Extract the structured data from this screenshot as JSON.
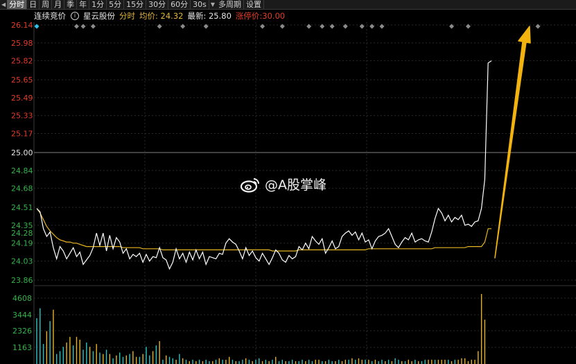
{
  "toolbar": {
    "items": [
      "分时",
      "日",
      "周",
      "月",
      "季",
      "年",
      "1分",
      "5分",
      "15分",
      "30分",
      "60分",
      "30s",
      "多周期",
      "设置"
    ],
    "active_index": 0
  },
  "info": {
    "auction_label": "连续竞价",
    "stock_name": "星云股份",
    "mode": "分时",
    "avg_text": "均价: 24.32",
    "latest_text": "最新: 25.80",
    "limit_text": "涨停价:30.00"
  },
  "colors": {
    "price_line": "#ffffff",
    "avg_line": "#e6b422",
    "up": "#e23c2c",
    "down": "#35b34a",
    "volume_cyan": "#2ec4c4",
    "arrow": "#f2b30f",
    "grid": "#2a2a2a"
  },
  "chart_data": {
    "type": "line",
    "price_ticks": [
      "26.14",
      "25.98",
      "25.82",
      "25.65",
      "25.49",
      "25.33",
      "25.17",
      "25.00",
      "24.84",
      "24.68",
      "24.51",
      "24.35",
      "24.19",
      "24.03",
      "23.86"
    ],
    "price_markers": [
      "24.28"
    ],
    "ref_price": "25.00",
    "ylim": [
      23.86,
      26.14
    ],
    "volume_ticks": [
      "4608",
      "3444",
      "2326",
      "1163"
    ],
    "volume_max": 4608,
    "series": [
      {
        "values": [
          24.5,
          24.47,
          24.32,
          24.25,
          24.29,
          24.15,
          24.05,
          24.16,
          24.12,
          24.05,
          24.1,
          24.15,
          24.07,
          24.11,
          24.0,
          24.04,
          24.08,
          24.15,
          24.28,
          24.17,
          24.28,
          24.12,
          24.26,
          24.14,
          24.24,
          24.2,
          24.1,
          24.14,
          24.05,
          24.09,
          24.07,
          24.1,
          24.02,
          24.09,
          24.03,
          24.07,
          24.06,
          24.15,
          24.06,
          24.04,
          23.96,
          24.02,
          24.14,
          24.05,
          24.1,
          24.02,
          24.11,
          24.04,
          24.13,
          24.05,
          24.11,
          24.0,
          24.07,
          24.06,
          24.05,
          24.1,
          24.09,
          24.19,
          24.23,
          24.2,
          24.18,
          24.12,
          24.05,
          24.15,
          24.08,
          24.12,
          24.06,
          24.03,
          24.1,
          24.05,
          24.0,
          24.06,
          24.13,
          24.1,
          24.04,
          24.02,
          24.08,
          24.05,
          24.07,
          24.16,
          24.13,
          24.19,
          24.14,
          24.25,
          24.21,
          24.18,
          24.23,
          24.1,
          24.15,
          24.21,
          24.14,
          24.16,
          24.25,
          24.28,
          24.3,
          24.26,
          24.29,
          24.22,
          24.28,
          24.2,
          24.22,
          24.14,
          24.21,
          24.25,
          24.26,
          24.28,
          24.32,
          24.25,
          24.18,
          24.15,
          24.2,
          24.24,
          24.22,
          24.28,
          24.2,
          24.22,
          24.23,
          24.21,
          24.2,
          24.29,
          24.41,
          24.5,
          24.46,
          24.39,
          24.44,
          24.38,
          24.42,
          24.4,
          24.44,
          24.35,
          24.36,
          24.34,
          24.38,
          24.39,
          24.5,
          24.76,
          25.8,
          25.82
        ],
        "avg": [
          24.5,
          24.46,
          24.4,
          24.34,
          24.3,
          24.27,
          24.24,
          24.22,
          24.21,
          24.2,
          24.2,
          24.19,
          24.19,
          24.18,
          24.17,
          24.16,
          24.16,
          24.16,
          24.16,
          24.16,
          24.16,
          24.16,
          24.16,
          24.16,
          24.16,
          24.16,
          24.15,
          24.15,
          24.15,
          24.15,
          24.15,
          24.15,
          24.14,
          24.14,
          24.14,
          24.14,
          24.14,
          24.14,
          24.13,
          24.13,
          24.13,
          24.13,
          24.13,
          24.13,
          24.13,
          24.13,
          24.13,
          24.13,
          24.13,
          24.13,
          24.13,
          24.13,
          24.13,
          24.13,
          24.13,
          24.13,
          24.13,
          24.13,
          24.13,
          24.13,
          24.13,
          24.13,
          24.13,
          24.13,
          24.13,
          24.13,
          24.13,
          24.13,
          24.13,
          24.13,
          24.13,
          24.12,
          24.12,
          24.12,
          24.12,
          24.12,
          24.12,
          24.12,
          24.12,
          24.13,
          24.13,
          24.13,
          24.13,
          24.13,
          24.13,
          24.13,
          24.13,
          24.13,
          24.13,
          24.13,
          24.13,
          24.13,
          24.13,
          24.13,
          24.13,
          24.13,
          24.13,
          24.13,
          24.13,
          24.13,
          24.14,
          24.14,
          24.14,
          24.14,
          24.14,
          24.14,
          24.14,
          24.14,
          24.14,
          24.14,
          24.14,
          24.14,
          24.14,
          24.14,
          24.14,
          24.14,
          24.14,
          24.14,
          24.14,
          24.14,
          24.15,
          24.15,
          24.15,
          24.15,
          24.15,
          24.15,
          24.15,
          24.15,
          24.15,
          24.15,
          24.16,
          24.16,
          24.16,
          24.16,
          24.16,
          24.2,
          24.32,
          24.32
        ]
      }
    ],
    "volumes": [
      3200,
      3900,
      1400,
      2300,
      3000,
      3800,
      700,
      900,
      1200,
      1500,
      1900,
      1300,
      1900,
      1700,
      1000,
      1500,
      1200,
      900,
      1400,
      800,
      700,
      1000,
      700,
      400,
      600,
      800,
      500,
      600,
      700,
      900,
      500,
      500,
      700,
      1200,
      600,
      900,
      1300,
      1600,
      300,
      600,
      500,
      400,
      300,
      700,
      400,
      300,
      200,
      300,
      200,
      300,
      200,
      300,
      200,
      200,
      300,
      400,
      300,
      300,
      500,
      300,
      200,
      200,
      300,
      400,
      300,
      200,
      300,
      400,
      200,
      300,
      200,
      300,
      500,
      200,
      300,
      200,
      200,
      300,
      200,
      200,
      300,
      200,
      300,
      200,
      300,
      300,
      200,
      200,
      300,
      200,
      200,
      300,
      200,
      300,
      300,
      400,
      300,
      400,
      300,
      300,
      300,
      200,
      300,
      200,
      300,
      200,
      300,
      200,
      400,
      300,
      200,
      200,
      300,
      200,
      300,
      200,
      200,
      300,
      300,
      300,
      300,
      300,
      300,
      300,
      300,
      200,
      300,
      300,
      400,
      400,
      200,
      300,
      300,
      900,
      4900,
      3100
    ],
    "volume_colors": [
      "cyan",
      "cyan",
      "cyan",
      "up",
      "cyan",
      "up",
      "cyan",
      "cyan",
      "cyan",
      "up",
      "up",
      "cyan",
      "up",
      "up",
      "cyan",
      "cyan",
      "up",
      "cyan",
      "up",
      "cyan",
      "up",
      "cyan",
      "up",
      "cyan",
      "up",
      "cyan",
      "cyan",
      "up",
      "cyan",
      "up",
      "up",
      "cyan",
      "up",
      "cyan",
      "cyan",
      "up",
      "cyan",
      "up",
      "cyan",
      "up",
      "cyan",
      "cyan",
      "up",
      "cyan",
      "up",
      "cyan",
      "up",
      "cyan",
      "up",
      "cyan",
      "up",
      "cyan",
      "cyan",
      "up",
      "cyan",
      "up",
      "cyan",
      "up",
      "up",
      "cyan",
      "up",
      "cyan",
      "cyan",
      "up",
      "cyan",
      "up",
      "cyan",
      "cyan",
      "up",
      "cyan",
      "up",
      "cyan",
      "up",
      "cyan",
      "cyan",
      "up",
      "cyan",
      "cyan",
      "up",
      "cyan",
      "cyan",
      "up",
      "cyan",
      "cyan",
      "up",
      "up",
      "cyan",
      "up",
      "cyan",
      "cyan",
      "up",
      "cyan",
      "up",
      "up",
      "cyan",
      "up",
      "cyan",
      "up",
      "up",
      "cyan",
      "up",
      "cyan",
      "up",
      "cyan",
      "cyan",
      "up",
      "cyan",
      "up",
      "cyan",
      "cyan",
      "up",
      "cyan",
      "up",
      "up",
      "cyan",
      "up",
      "cyan",
      "cyan",
      "up",
      "up",
      "cyan",
      "up",
      "up",
      "up",
      "cyan",
      "up",
      "cyan",
      "up",
      "up",
      "up",
      "up",
      "up",
      "up",
      "up",
      "up",
      "up",
      "up"
    ],
    "event_markers": [
      0,
      12,
      14,
      17,
      37,
      44,
      51,
      68,
      74,
      82,
      86,
      89,
      93,
      98,
      101,
      104,
      125,
      130,
      151
    ],
    "grid": true
  },
  "watermark": {
    "text": "@A股掌峰",
    "icon": "weibo-icon"
  }
}
